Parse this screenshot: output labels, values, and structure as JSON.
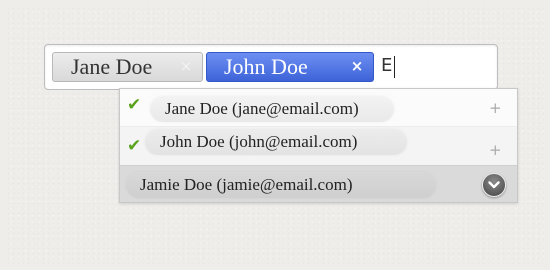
{
  "token_input": {
    "tokens": [
      {
        "label": "Jane Doe",
        "remove_icon": "close-icon",
        "selected": false
      },
      {
        "label": "John Doe",
        "remove_icon": "close-icon",
        "selected": true
      }
    ],
    "typed_text": "E"
  },
  "suggestions": [
    {
      "label": "Jane Doe (jane@email.com)",
      "checked": true,
      "action_icon": "plus-icon"
    },
    {
      "label": "John Doe (john@email.com)",
      "checked": true,
      "action_icon": "plus-icon"
    },
    {
      "label": "Jamie Doe (jamie@email.com)",
      "checked": false,
      "action_icon": "chevron-down-circle-icon",
      "highlighted": true
    }
  ],
  "colors": {
    "selected_token": "#3d63d8",
    "check": "#5aa31e",
    "highlight_row": "#dadada"
  }
}
